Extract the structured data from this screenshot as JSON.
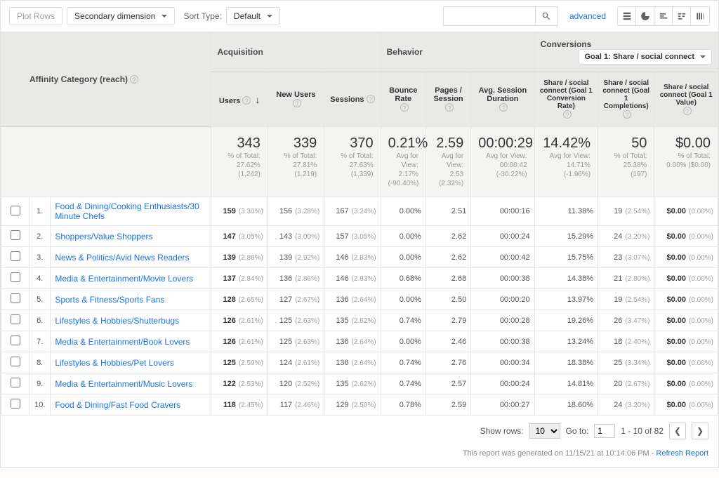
{
  "toolbar": {
    "plotRows": "Plot Rows",
    "secondaryDim": "Secondary dimension",
    "sortTypeLabel": "Sort Type:",
    "default": "Default",
    "advanced": "advanced"
  },
  "headers": {
    "primary": "Affinity Category (reach)",
    "acquisition": "Acquisition",
    "behavior": "Behavior",
    "conversions": "Conversions",
    "convGoal": "Goal 1: Share / social connect",
    "users": "Users",
    "newUsers": "New Users",
    "sessions": "Sessions",
    "bounce": "Bounce Rate",
    "pages": "Pages / Session",
    "avg": "Avg. Session Duration",
    "goalRate": "Share / social connect (Goal 1 Conversion Rate)",
    "goalCompl": "Share / social connect (Goal 1 Completions)",
    "goalValue": "Share / social connect (Goal 1 Value)"
  },
  "totals": {
    "users": {
      "big": "343",
      "sub": "% of Total: 27.62% (1,242)"
    },
    "newUsers": {
      "big": "339",
      "sub": "% of Total: 27.81% (1,219)"
    },
    "sessions": {
      "big": "370",
      "sub": "% of Total: 27.63% (1,339)"
    },
    "bounce": {
      "big": "0.21%",
      "sub": "Avg for View: 2.17% (-90.40%)"
    },
    "pages": {
      "big": "2.59",
      "sub": "Avg for View: 2.53 (2.32%)"
    },
    "avg": {
      "big": "00:00:29",
      "sub": "Avg for View: 00:00:42 (-30.22%)"
    },
    "rate": {
      "big": "14.42%",
      "sub": "Avg for View: 14.71% (-1.96%)"
    },
    "compl": {
      "big": "50",
      "sub": "% of Total: 25.38% (197)"
    },
    "value": {
      "big": "$0.00",
      "sub": "% of Total: 0.00% ($0.00)"
    }
  },
  "rows": [
    {
      "n": "1.",
      "name": "Food & Dining/Cooking Enthusiasts/30 Minute Chefs",
      "users": "159",
      "usersP": "(3.30%)",
      "new": "156",
      "newP": "(3.28%)",
      "sess": "167",
      "sessP": "(3.24%)",
      "bounce": "0.00%",
      "pages": "2.51",
      "avg": "00:00:16",
      "rate": "11.38%",
      "compl": "19",
      "complP": "(2.54%)",
      "val": "$0.00",
      "valP": "(0.00%)"
    },
    {
      "n": "2.",
      "name": "Shoppers/Value Shoppers",
      "users": "147",
      "usersP": "(3.05%)",
      "new": "143",
      "newP": "(3.00%)",
      "sess": "157",
      "sessP": "(3.05%)",
      "bounce": "0.00%",
      "pages": "2.62",
      "avg": "00:00:24",
      "rate": "15.29%",
      "compl": "24",
      "complP": "(3.20%)",
      "val": "$0.00",
      "valP": "(0.00%)"
    },
    {
      "n": "3.",
      "name": "News & Politics/Avid News Readers",
      "users": "139",
      "usersP": "(2.88%)",
      "new": "139",
      "newP": "(2.92%)",
      "sess": "146",
      "sessP": "(2.83%)",
      "bounce": "0.00%",
      "pages": "2.62",
      "avg": "00:00:42",
      "rate": "15.75%",
      "compl": "23",
      "complP": "(3.07%)",
      "val": "$0.00",
      "valP": "(0.00%)"
    },
    {
      "n": "4.",
      "name": "Media & Entertainment/Movie Lovers",
      "users": "137",
      "usersP": "(2.84%)",
      "new": "136",
      "newP": "(2.86%)",
      "sess": "146",
      "sessP": "(2.83%)",
      "bounce": "0.68%",
      "pages": "2.68",
      "avg": "00:00:38",
      "rate": "14.38%",
      "compl": "21",
      "complP": "(2.80%)",
      "val": "$0.00",
      "valP": "(0.00%)"
    },
    {
      "n": "5.",
      "name": "Sports & Fitness/Sports Fans",
      "users": "128",
      "usersP": "(2.65%)",
      "new": "127",
      "newP": "(2.67%)",
      "sess": "136",
      "sessP": "(2.64%)",
      "bounce": "0.00%",
      "pages": "2.50",
      "avg": "00:00:20",
      "rate": "13.97%",
      "compl": "19",
      "complP": "(2.54%)",
      "val": "$0.00",
      "valP": "(0.00%)"
    },
    {
      "n": "6.",
      "name": "Lifestyles & Hobbies/Shutterbugs",
      "users": "126",
      "usersP": "(2.61%)",
      "new": "125",
      "newP": "(2.63%)",
      "sess": "135",
      "sessP": "(2.62%)",
      "bounce": "0.74%",
      "pages": "2.79",
      "avg": "00:00:28",
      "rate": "19.26%",
      "compl": "26",
      "complP": "(3.47%)",
      "val": "$0.00",
      "valP": "(0.00%)"
    },
    {
      "n": "7.",
      "name": "Media & Entertainment/Book Lovers",
      "users": "126",
      "usersP": "(2.61%)",
      "new": "125",
      "newP": "(2.63%)",
      "sess": "136",
      "sessP": "(2.64%)",
      "bounce": "0.00%",
      "pages": "2.46",
      "avg": "00:00:38",
      "rate": "13.24%",
      "compl": "18",
      "complP": "(2.40%)",
      "val": "$0.00",
      "valP": "(0.00%)"
    },
    {
      "n": "8.",
      "name": "Lifestyles & Hobbies/Pet Lovers",
      "users": "125",
      "usersP": "(2.59%)",
      "new": "124",
      "newP": "(2.61%)",
      "sess": "136",
      "sessP": "(2.64%)",
      "bounce": "0.74%",
      "pages": "2.76",
      "avg": "00:00:34",
      "rate": "18.38%",
      "compl": "25",
      "complP": "(3.34%)",
      "val": "$0.00",
      "valP": "(0.00%)"
    },
    {
      "n": "9.",
      "name": "Media & Entertainment/Music Lovers",
      "users": "122",
      "usersP": "(2.53%)",
      "new": "120",
      "newP": "(2.52%)",
      "sess": "135",
      "sessP": "(2.62%)",
      "bounce": "0.74%",
      "pages": "2.57",
      "avg": "00:00:24",
      "rate": "14.81%",
      "compl": "20",
      "complP": "(2.67%)",
      "val": "$0.00",
      "valP": "(0.00%)"
    },
    {
      "n": "10.",
      "name": "Food & Dining/Fast Food Cravers",
      "users": "118",
      "usersP": "(2.45%)",
      "new": "117",
      "newP": "(2.46%)",
      "sess": "129",
      "sessP": "(2.50%)",
      "bounce": "0.78%",
      "pages": "2.59",
      "avg": "00:00:27",
      "rate": "18.60%",
      "compl": "24",
      "complP": "(3.20%)",
      "val": "$0.00",
      "valP": "(0.00%)"
    }
  ],
  "pagination": {
    "showRows": "Show rows:",
    "rowsVal": "10",
    "goTo": "Go to:",
    "goVal": "1",
    "range": "1 - 10 of 82"
  },
  "footer": {
    "generated": "This report was generated on 11/15/21 at 10:14:06 PM - ",
    "refresh": "Refresh Report"
  }
}
